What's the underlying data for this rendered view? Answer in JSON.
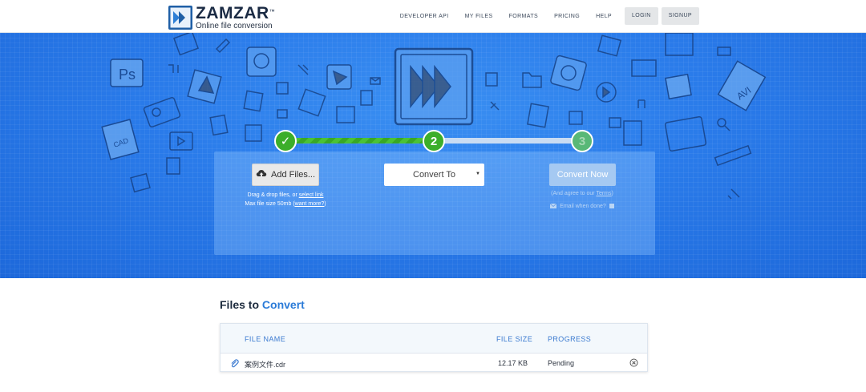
{
  "brand": {
    "name": "ZAMZAR",
    "tm": "™",
    "tagline": "Online file conversion"
  },
  "nav": {
    "items": [
      "DEVELOPER API",
      "MY FILES",
      "FORMATS",
      "PRICING",
      "HELP"
    ],
    "login": "LOGIN",
    "signup": "SIGNUP"
  },
  "steps": {
    "step1": "✓",
    "step2": "2",
    "step3": "3"
  },
  "upload": {
    "add_files": "Add Files...",
    "drag_text": "Drag & drop files, or ",
    "select_link": "select link",
    "max_text": "Max file size 50mb (",
    "want_more": "want more?",
    "max_close": ")"
  },
  "convert": {
    "convert_to": "Convert To",
    "convert_now": "Convert Now",
    "agree_pre": "(And agree to our ",
    "terms": "Terms",
    "agree_post": ")",
    "email": "Email when done?"
  },
  "files": {
    "title_a": "Files to ",
    "title_b": "Convert",
    "headers": {
      "name": "FILE NAME",
      "size": "FILE SIZE",
      "progress": "PROGRESS"
    },
    "rows": [
      {
        "name": "案例文件.cdr",
        "size": "12.17 KB",
        "progress": "Pending"
      }
    ]
  },
  "colors": {
    "hero": "#2a7bea",
    "step_green": "#3cae2a",
    "accent_blue": "#2b7bd8"
  }
}
